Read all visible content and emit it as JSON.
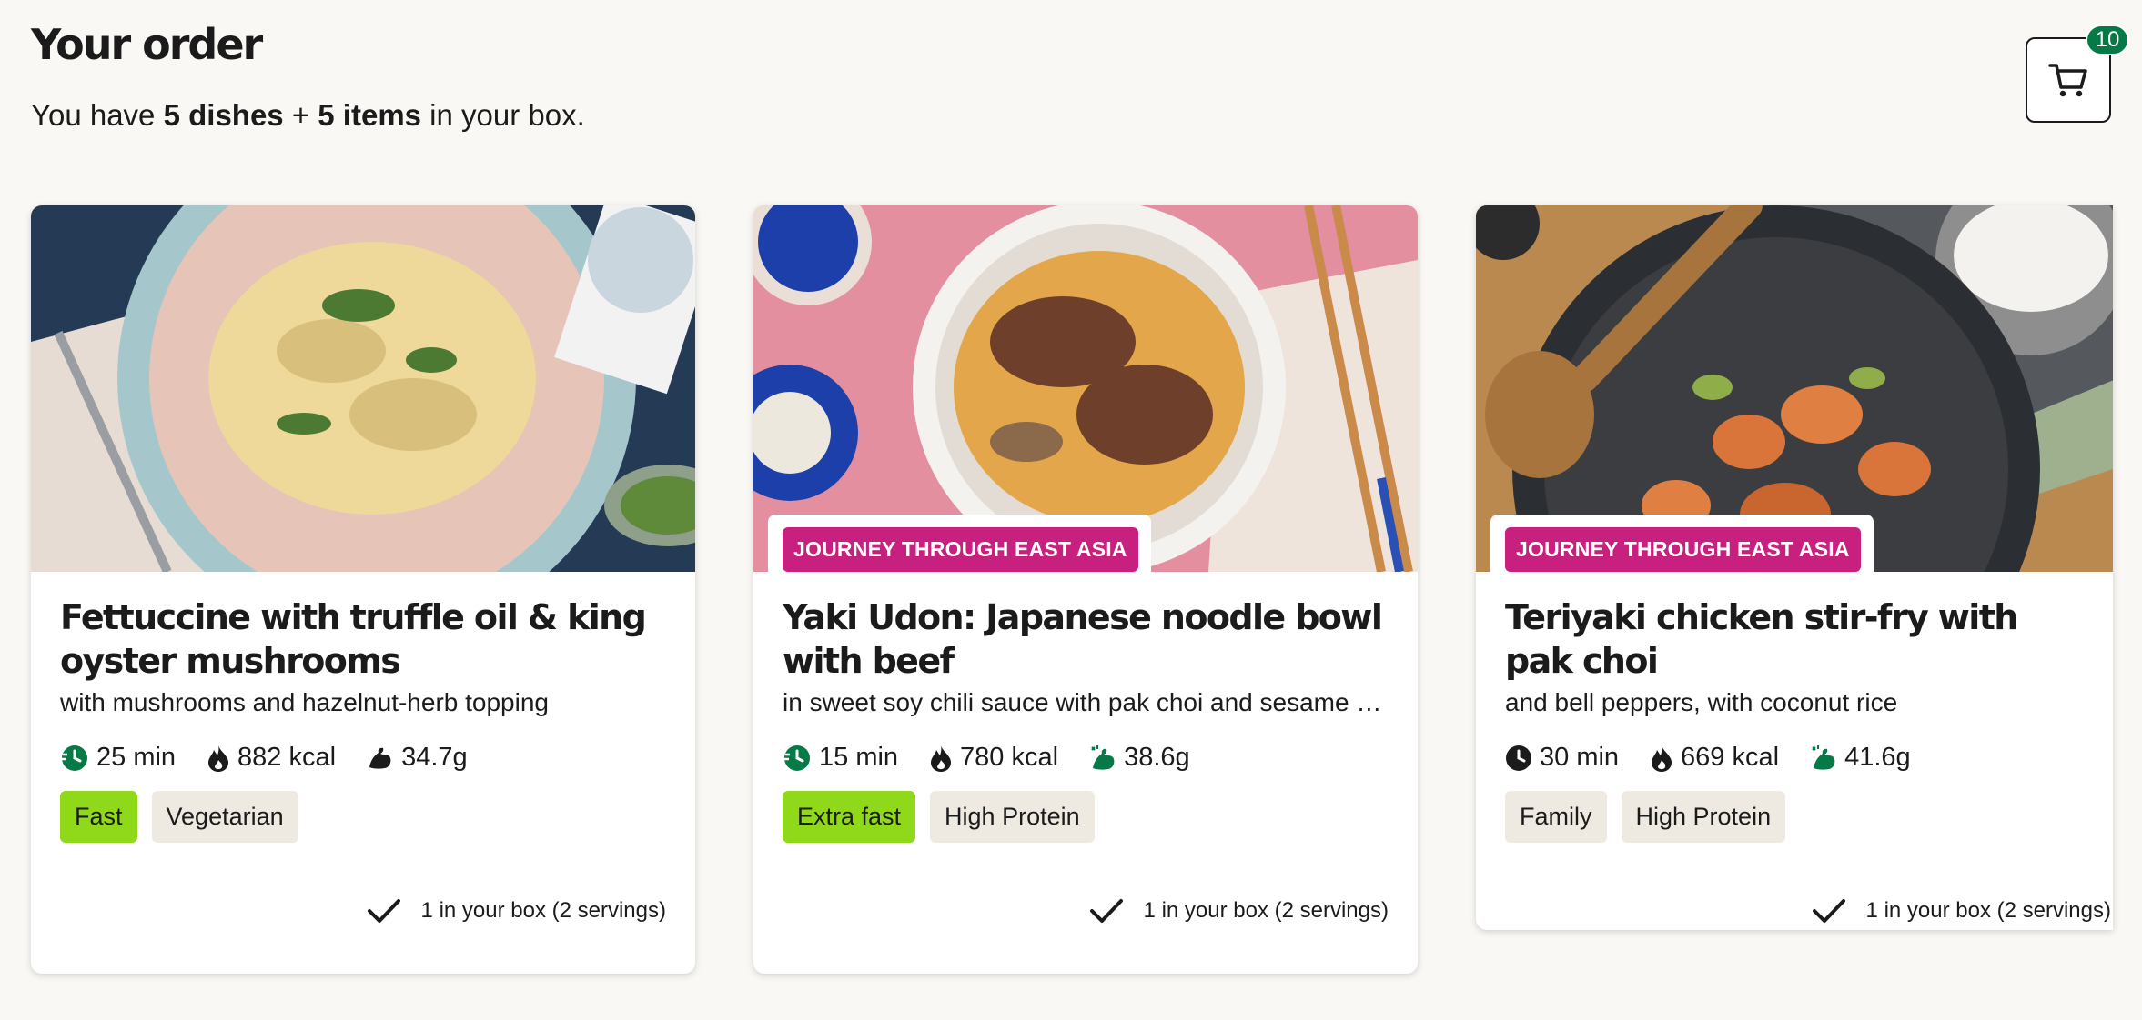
{
  "header": {
    "title": "Your order",
    "summary_prefix": "You have ",
    "summary_dishes": "5 dishes",
    "summary_plus": " + ",
    "summary_items": "5 items",
    "summary_suffix": " in your box."
  },
  "cart": {
    "icon": "cart-icon",
    "count": "10",
    "badge_color": "#067a46"
  },
  "colors": {
    "tag": "#c8207e",
    "chip_green": "#8fd81a",
    "chip_neutral": "#eeeae2",
    "background": "#faf8f4"
  },
  "cards": [
    {
      "image": "fettuccine-image",
      "title": "Fettuccine with truffle oil & king oyster mushrooms",
      "subtitle": "with mushrooms and hazelnut-herb topping",
      "time": "25 min",
      "time_icon": "fast-clock-icon",
      "kcal": "882 kcal",
      "kcal_icon": "flame-icon",
      "protein": "34.7g",
      "protein_icon": "muscle-icon",
      "chips": [
        "Fast",
        "Vegetarian"
      ],
      "in_box": "1 in your box (2 servings)"
    },
    {
      "image": "yaki-udon-image",
      "tag": "JOURNEY THROUGH EAST ASIA",
      "title": "Yaki Udon: Japanese noodle bowl with beef",
      "subtitle": "in sweet soy chili sauce with pak choi and sesame seeds",
      "time": "15 min",
      "time_icon": "fast-clock-icon",
      "kcal": "780 kcal",
      "kcal_icon": "flame-icon",
      "protein": "38.6g",
      "protein_icon": "protein-icon",
      "chips": [
        "Extra fast",
        "High Protein"
      ],
      "in_box": "1 in your box (2 servings)"
    },
    {
      "image": "teriyaki-chicken-image",
      "tag": "JOURNEY THROUGH EAST ASIA",
      "title": "Teriyaki chicken stir-fry with pak choi",
      "subtitle": "and bell peppers, with coconut rice",
      "time": "30 min",
      "time_icon": "clock-icon",
      "kcal": "669 kcal",
      "kcal_icon": "flame-icon",
      "protein": "41.6g",
      "protein_icon": "protein-icon",
      "chips": [
        "Family",
        "High Protein"
      ],
      "in_box": "1 in your box (2 servings)"
    }
  ]
}
